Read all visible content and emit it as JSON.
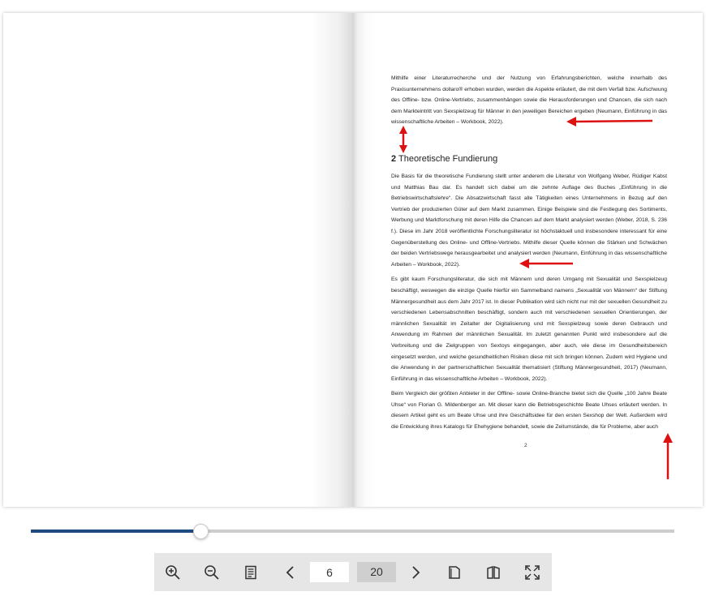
{
  "document": {
    "right_page": {
      "paragraph_intro": "Mithilfe einer Literaturrecherche und der Nutzung von Erfahrungsberichten, welche innerhalb des Praxisunternehmens dollaro® erhoben wurden, werden die Aspekte erläutert, die mit dem Verfall bzw. Aufschwung des Offline- bzw. Online-Vertriebs, zusammenhängen sowie die Herausforderungen und Chancen, die sich nach dem Markteintritt von Sexspielzeug für Männer in den jeweiligen Bereichen ergeben (Neumann, Einführung in das wissenschaftliche Arbeiten – Workbook, 2022).",
      "heading_number": "2",
      "heading_text": "Theoretische Fundierung",
      "paragraph_1": "Die Basis für die theoretische Fundierung stellt unter anderem die Literatur von Wolfgang Weber, Rüdiger Kabst und Matthias Bau dar. Es handelt sich dabei um die zehnte Auflage des Buches „Einführung in die Betriebswirtschaftslehre“. Die Absatzwirtschaft fasst alle Tätigkeiten eines Unternehmens in Bezug auf den Vertrieb der produzierten Güter auf dem Markt zusammen. Einige Beispiele sind die Festlegung des Sortiments, Werbung und Marktforschung mit deren Hilfe die Chancen auf dem Markt analysiert werden (Weber, 2018, S. 236 f.). Diese im Jahr 2018 veröffentlichte Forschungsliteratur ist höchstaktuell und insbesondere interessant für eine Gegenüberstellung des Online- und Offline-Vertriebs. Mithilfe dieser Quelle können die Stärken und Schwächen der beiden Vertriebswege herausgearbeitet und analysiert werden (Neumann, Einführung in das wissenschaftliche Arbeiten – Workbook, 2022).",
      "paragraph_2": "Es gibt kaum Forschungsliteratur, die sich mit Männern und deren Umgang mit Sexualität und Sexspielzeug beschäftigt, weswegen die einzige Quelle hierfür ein Sammelband namens „Sexualität von Männern“ der Stiftung Männergesundheit aus dem Jahr 2017 ist. In dieser Publikation wird sich nicht nur mit der sexuellen Gesundheit zu verschiedenen Lebensabschnitten beschäftigt, sondern auch mit verschiedenen sexuellen Orientierungen, der männlichen Sexualität im Zeitalter der Digitalisierung und mit Sexspielzeug sowie deren Gebrauch und Anwendung im Rahmen der männlichen Sexualität. Im zuletzt genannten Punkt wird insbesondere auf die Verbreitung und die Zielgruppen von Sextoys eingegangen, aber auch, wie diese im Gesundheitsbereich eingesetzt werden, und welche gesundheitlichen Risiken diese mit sich bringen können. Zudem wird Hygiene und die Anwendung in der partnerschaftlichen Sexualität thematisiert (Stiftung Männergesundheit, 2017) (Neumann, Einführung in das wissenschaftliche Arbeiten – Workbook, 2022).",
      "paragraph_3": "Beim Vergleich der größten Anbieter in der Offline- sowie Online-Branche bietet sich die Quelle „100 Jahre Beate Uhse“ von Florian G. Mildenberger an. Mit dieser kann die Betriebsgeschichte Beate Uhses erläutert werden. In diesem Artikel geht es um Beate Uhse und ihre Geschäftsidee für den ersten Sexshop der Welt. Außerdem wird die Entwicklung ihres Katalogs für Ehehygiene behandelt, sowie die Zeitumstände, die für Probleme, aber auch",
      "page_number": "2"
    }
  },
  "viewer": {
    "progress": 0.263,
    "current_page": "6",
    "total_pages": "20",
    "accent_color": "#1e4a80",
    "annotation_color": "#dd1111"
  },
  "toolbar_icons": [
    "zoom-in-icon",
    "zoom-out-icon",
    "table-of-contents-icon",
    "chevron-left-icon",
    "chevron-right-icon",
    "single-page-icon",
    "double-page-icon",
    "fullscreen-icon"
  ]
}
